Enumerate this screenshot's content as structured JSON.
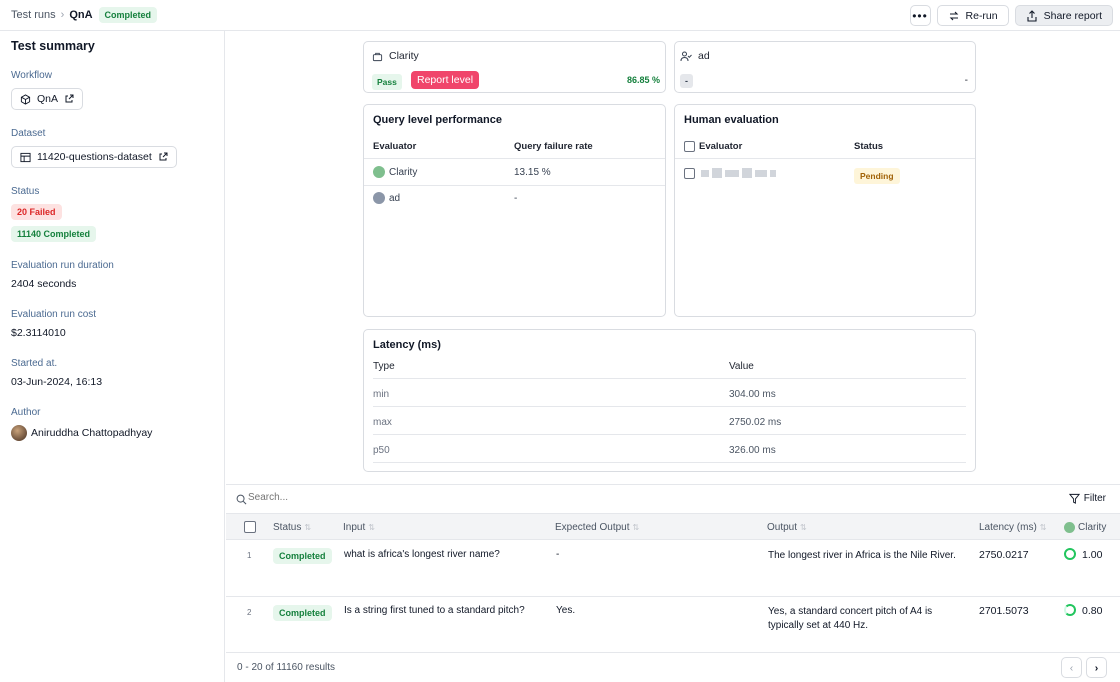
{
  "breadcrumb": {
    "root": "Test runs",
    "current": "QnA",
    "status": "Completed"
  },
  "toolbar": {
    "rerun": "Re-run",
    "share": "Share report"
  },
  "summary": {
    "title": "Test summary",
    "workflow_label": "Workflow",
    "workflow_value": "QnA",
    "dataset_label": "Dataset",
    "dataset_value": "11420-questions-dataset",
    "status_label": "Status",
    "failed": "20 Failed",
    "completed": "11140 Completed",
    "duration_label": "Evaluation run duration",
    "duration_value": "2404 seconds",
    "cost_label": "Evaluation run cost",
    "cost_value": "$2.3114010",
    "started_label": "Started at.",
    "started_value": "03-Jun-2024, 16:13",
    "author_label": "Author",
    "author_value": "Aniruddha Chattopadhyay"
  },
  "report": {
    "clarity_title": "Clarity",
    "clarity_badge": "Pass",
    "clarity_value": "86.85 %",
    "tooltip": "Report level",
    "ad_title": "ad",
    "ad_badge": "-",
    "ad_value": "-"
  },
  "query_perf": {
    "title": "Query level performance",
    "col_evaluator": "Evaluator",
    "col_rate": "Query failure rate",
    "rows": [
      {
        "name": "Clarity",
        "rate": "13.15 %"
      },
      {
        "name": "ad",
        "rate": "-"
      }
    ]
  },
  "human_eval": {
    "title": "Human evaluation",
    "col_evaluator": "Evaluator",
    "col_status": "Status",
    "row_status": "Pending"
  },
  "latency": {
    "title": "Latency (ms)",
    "col_type": "Type",
    "col_value": "Value",
    "rows": [
      {
        "type": "min",
        "value": "304.00 ms"
      },
      {
        "type": "max",
        "value": "2750.02 ms"
      },
      {
        "type": "p50",
        "value": "326.00 ms"
      }
    ]
  },
  "search": {
    "placeholder": "Search...",
    "filter": "Filter"
  },
  "grid": {
    "headers": {
      "status": "Status",
      "input": "Input",
      "expected": "Expected Output",
      "output": "Output",
      "latency": "Latency (ms)",
      "clarity": "Clarity"
    },
    "rows": [
      {
        "index": "1",
        "status": "Completed",
        "input": "what is africa's longest river name?",
        "expected": "-",
        "output": "The longest river in Africa is the Nile River.",
        "latency": "2750.0217",
        "score": "1.00"
      },
      {
        "index": "2",
        "status": "Completed",
        "input": "Is a string first tuned to a standard pitch?",
        "expected": "Yes.",
        "output": "Yes, a standard concert pitch of A4 is typically set at 440 Hz.",
        "latency": "2701.5073",
        "score": "0.80"
      }
    ]
  },
  "pagination": {
    "summary": "0 - 20 of 11160 results"
  },
  "colors": {
    "accent_green": "#22c55e",
    "tooltip_pink": "#f0456b"
  },
  "icons": [
    "chevron-right-icon",
    "more-icon",
    "rerun-icon",
    "share-icon",
    "workflow-icon",
    "external-link-icon",
    "table-icon",
    "clarity-icon",
    "user-check-icon",
    "search-icon",
    "filter-icon",
    "chevron-left-icon"
  ]
}
